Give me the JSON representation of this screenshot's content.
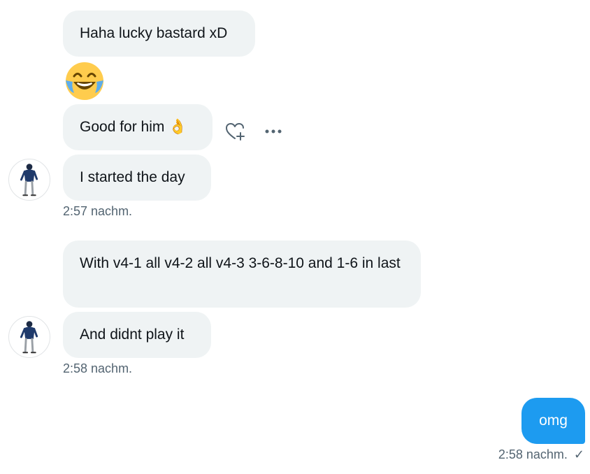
{
  "conversation": {
    "messages": [
      {
        "text": "Haha lucky bastard xD"
      },
      {
        "emoji": "😂",
        "icon": "face-with-tears-of-joy"
      },
      {
        "text": "Good for him 👌"
      },
      {
        "text": "I started the day"
      },
      {
        "text": "With v4-1 all v4-2 all v4-3 3-6-8-10 and 1-6 in last"
      },
      {
        "text": "And didnt play it"
      },
      {
        "text": "omg"
      }
    ],
    "timestamps": [
      "2:57 nachm.",
      "2:58 nachm.",
      "2:58 nachm."
    ],
    "read_receipt": "✓"
  },
  "actions": {
    "react_icon": "heart-plus-icon",
    "more_icon": "more-horizontal-icon"
  },
  "colors": {
    "incoming_bubble": "#eff3f4",
    "outgoing_bubble": "#1d9bf0",
    "timestamp": "#536471",
    "text": "#0f1419"
  }
}
